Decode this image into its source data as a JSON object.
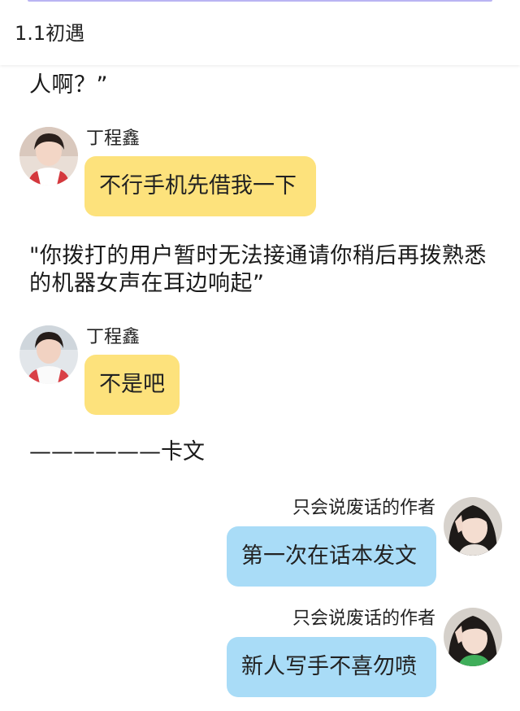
{
  "header": {
    "title": "1.1初遇"
  },
  "story": {
    "partial_line": "人啊？”",
    "narration": "\"你拨打的用户暂时无法接通请你稍后再拨熟悉的机器女声在耳边响起”",
    "separator": "——————卡文"
  },
  "messages": [
    {
      "sender": "丁程鑫",
      "text": "不行手机先借我一下",
      "side": "left",
      "bubble_color": "#fde27c"
    },
    {
      "sender": "丁程鑫",
      "text": "不是吧",
      "side": "left",
      "bubble_color": "#fde27c"
    },
    {
      "sender": "只会说废话的作者",
      "text": "第一次在话本发文",
      "side": "right",
      "bubble_color": "#a9dcf7"
    },
    {
      "sender": "只会说废话的作者",
      "text": "新人写手不喜勿喷",
      "side": "right",
      "bubble_color": "#a9dcf7"
    }
  ]
}
